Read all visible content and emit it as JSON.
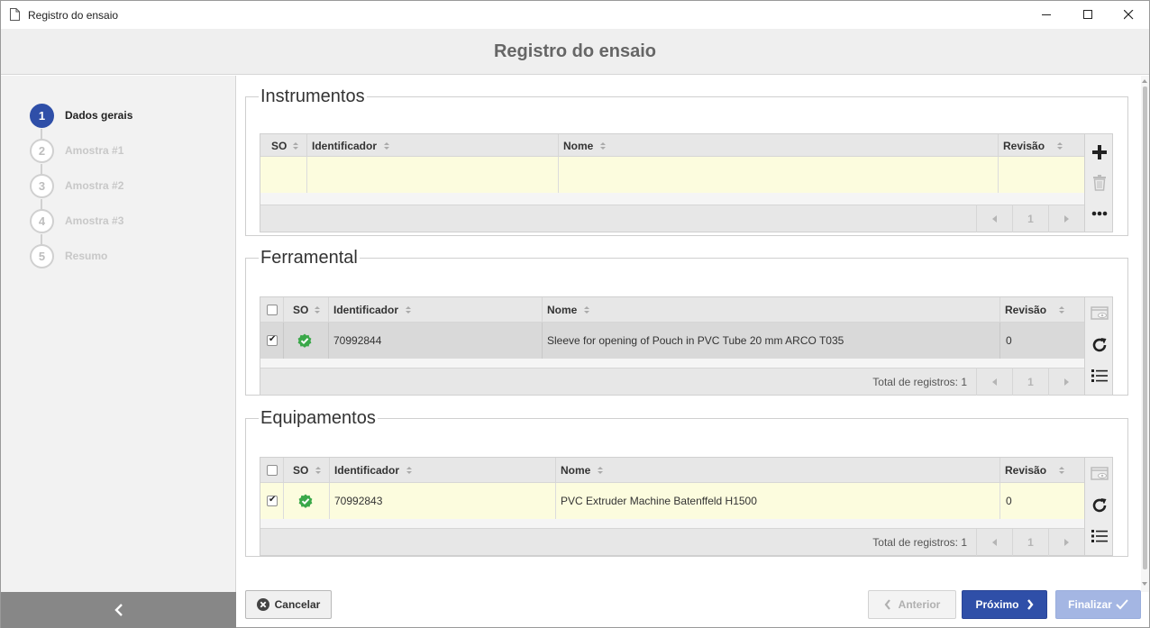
{
  "window": {
    "title": "Registro do ensaio",
    "controls": [
      "minimize-icon",
      "maximize-icon",
      "close-icon"
    ]
  },
  "header": {
    "title": "Registro do ensaio"
  },
  "steps": [
    {
      "num": "1",
      "label": "Dados gerais",
      "active": true
    },
    {
      "num": "2",
      "label": "Amostra #1",
      "active": false
    },
    {
      "num": "3",
      "label": "Amostra #2",
      "active": false
    },
    {
      "num": "4",
      "label": "Amostra #3",
      "active": false
    },
    {
      "num": "5",
      "label": "Resumo",
      "active": false
    }
  ],
  "instrumentos": {
    "title": "Instrumentos",
    "columns": {
      "so": "SO",
      "identificador": "Identificador",
      "nome": "Nome",
      "revisao": "Revisão"
    },
    "rows": [],
    "page": "1"
  },
  "ferramental": {
    "title": "Ferramental",
    "columns": {
      "so": "SO",
      "identificador": "Identificador",
      "nome": "Nome",
      "revisao": "Revisão"
    },
    "rows": [
      {
        "checked": true,
        "status": "verified-badge-icon",
        "identificador": "70992844",
        "nome": "Sleeve for opening of Pouch in PVC Tube 20 mm ARCO T035",
        "revisao": "0"
      }
    ],
    "total": "Total de registros: 1",
    "page": "1"
  },
  "equipamentos": {
    "title": "Equipamentos",
    "columns": {
      "so": "SO",
      "identificador": "Identificador",
      "nome": "Nome",
      "revisao": "Revisão"
    },
    "rows": [
      {
        "checked": true,
        "status": "verified-badge-icon",
        "identificador": "70992843",
        "nome": "PVC Extruder Machine Batenffeld H1500",
        "revisao": "0"
      }
    ],
    "total": "Total de registros: 1",
    "page": "1"
  },
  "footer": {
    "cancel": "Cancelar",
    "previous": "Anterior",
    "next": "Próximo",
    "finish": "Finalizar"
  },
  "colors": {
    "accent": "#2f4fa8",
    "selected_row": "#fcfcde",
    "status_green": "#3aa849"
  }
}
